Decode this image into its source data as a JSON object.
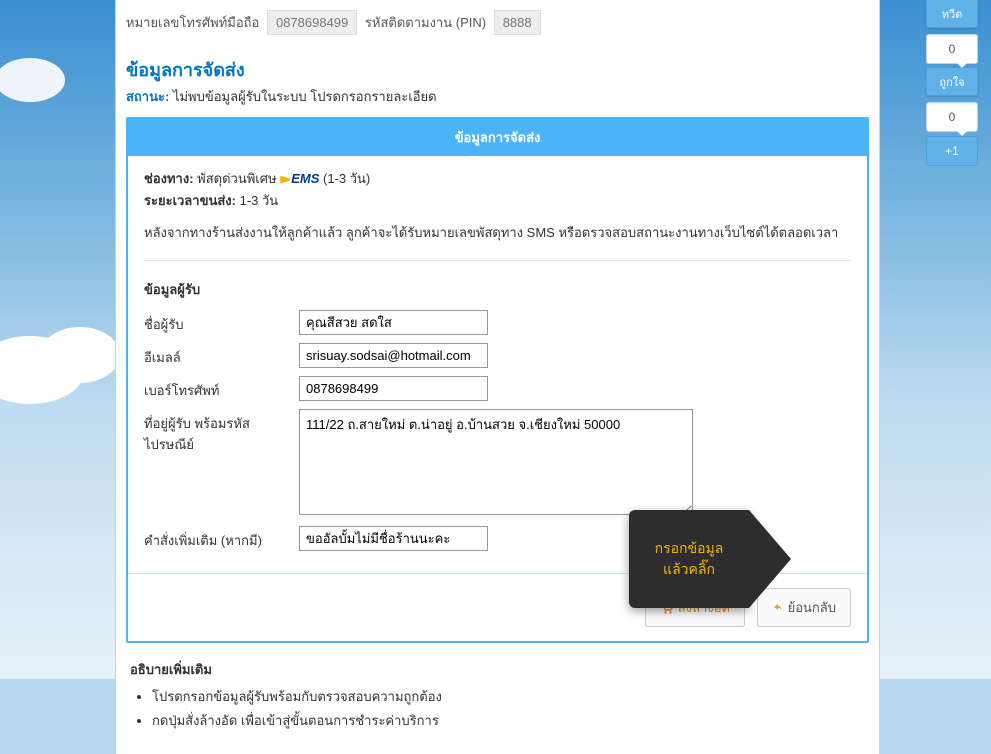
{
  "top": {
    "phone_label": "หมายเลขโทรศัพท์มือถือ",
    "phone_value": "0878698499",
    "pin_label": "รหัสติดตามงาน (PIN)",
    "pin_value": "8888"
  },
  "section_title": "ข้อมูลการจัดส่ง",
  "status": {
    "label": "สถานะ:",
    "text": "ไม่พบข้อมูลผู้รับในระบบ โปรดกรอกรายละเอียด"
  },
  "ship": {
    "header": "ข้อมูลการจัดส่ง",
    "channel_label": "ช่องทาง:",
    "channel_value_prefix": "พัสดุด่วนพิเศษ",
    "channel_ems": "EMS",
    "channel_value_suffix": "(1-3 วัน)",
    "duration_label": "ระยะเวลาขนส่ง:",
    "duration_value": "1-3 วัน",
    "note": "หลังจากทางร้านส่งงานให้ลูกค้าแล้ว ลูกค้าจะได้รับหมายเลขพัสดุทาง SMS หรือตรวจสอบสถานะงานทางเว็บไซต์ได้ตลอดเวลา"
  },
  "recipient": {
    "heading": "ข้อมูลผู้รับ",
    "name_label": "ชื่อผู้รับ",
    "name_value": "คุณสีสวย สดใส",
    "email_label": "อีเมลล์",
    "email_value": "srisuay.sodsai@hotmail.com",
    "phone_label": "เบอร์โทรศัพท์",
    "phone_value": "0878698499",
    "address_label": "ที่อยู่ผู้รับ พร้อมรหัสไปรษณีย์",
    "address_value": "111/22 ถ.สายใหม่ ต.น่าอยู่ อ.บ้านสวย จ.เชียงใหม่ 50000",
    "extra_label": "คำสั่งเพิ่มเติม (หากมี)",
    "extra_value": "ขออัลบั้มไม่มีชื่อร้านนะคะ"
  },
  "buttons": {
    "submit": "สั่งล้างอัด",
    "back": "ย้อนกลับ"
  },
  "callout": {
    "line1": "กรอกข้อมูล",
    "line2": "แล้วคลิ๊ก"
  },
  "explain": {
    "heading": "อธิบายเพิ่มเติม",
    "items": [
      "โปรดกรอกข้อมูลผู้รับพร้อมกับตรวจสอบความถูกต้อง",
      "กดปุ่มสั่งล้างอัด เพื่อเข้าสู่ขั้นตอนการชำระค่าบริการ"
    ]
  },
  "sidebar": {
    "tweet": "ทวีต",
    "count0": "0",
    "like": "ถูกใจ",
    "count1": "0",
    "plus": "+1"
  }
}
